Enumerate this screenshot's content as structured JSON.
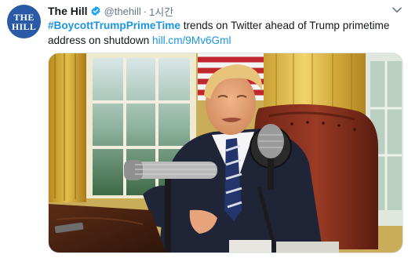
{
  "tweet": {
    "avatar_line1": "THE",
    "avatar_line2": "HILL",
    "name": "The Hill",
    "handle": "@thehill",
    "separator": "·",
    "time": "1시간",
    "hashtag": "#BoycottTrumpPrimeTime",
    "text": " trends on Twitter ahead of Trump primetime address on shutdown ",
    "link": "hill.cm/9Mv6Gml"
  },
  "icons": {
    "verified": "verified-badge-icon",
    "caret": "chevron-down-icon"
  },
  "colors": {
    "avatar_bg": "#2a5aa6",
    "accent": "#1b95e0",
    "secondary_text": "#657786"
  }
}
